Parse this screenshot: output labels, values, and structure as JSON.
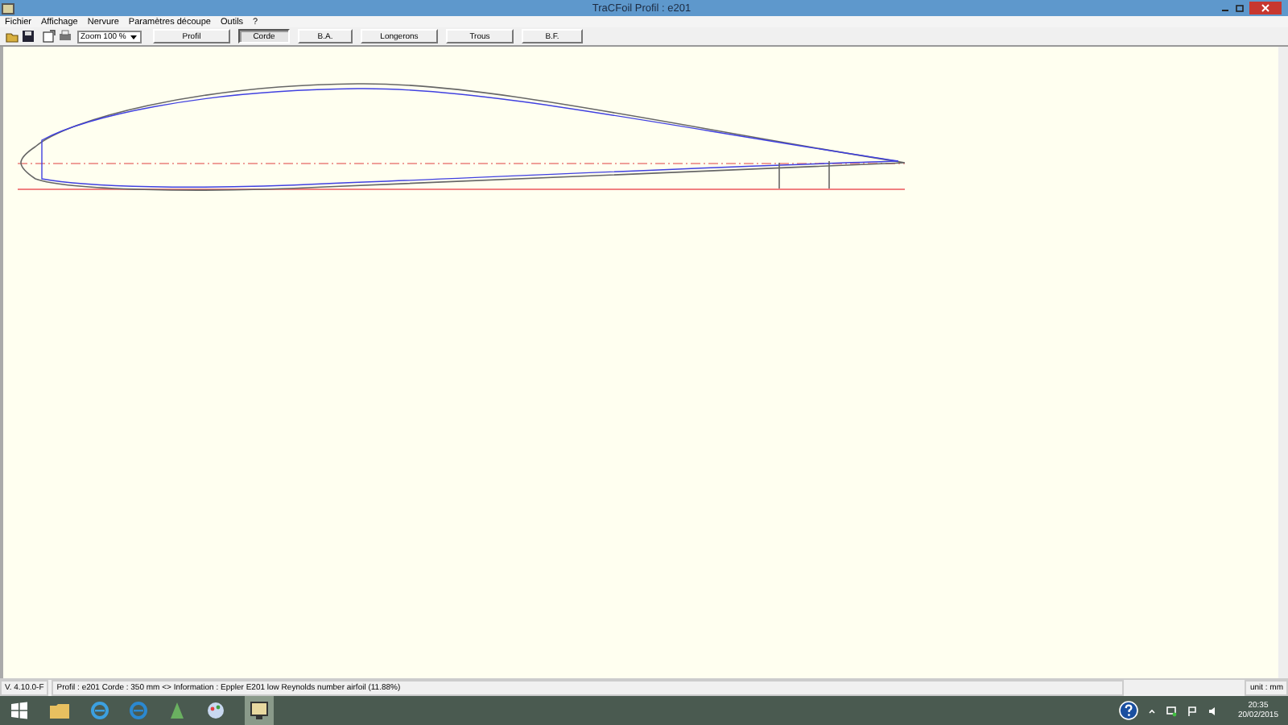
{
  "window": {
    "title": "TraCFoil Profil : e201"
  },
  "menu": [
    "Fichier",
    "Affichage",
    "Nervure",
    "Paramètres découpe",
    "Outils",
    "?"
  ],
  "toolbar": {
    "zoom": "Zoom 100 %",
    "tabs": [
      {
        "label": "Profil",
        "selected": false
      },
      {
        "label": "Corde",
        "selected": true
      },
      {
        "label": "B.A.",
        "selected": false
      },
      {
        "label": "Longerons",
        "selected": false
      },
      {
        "label": "Trous",
        "selected": false
      },
      {
        "label": "B.F.",
        "selected": false
      }
    ]
  },
  "status_bar": {
    "version": "V. 4.10.0-F",
    "info": "Profil : e201  Corde : 350 mm <> Information : Eppler E201 low Reynolds number airfoil  (11.88%)",
    "unit": "unit : mm"
  },
  "taskbar": {
    "time": "20:35",
    "date": "20/02/2015"
  }
}
